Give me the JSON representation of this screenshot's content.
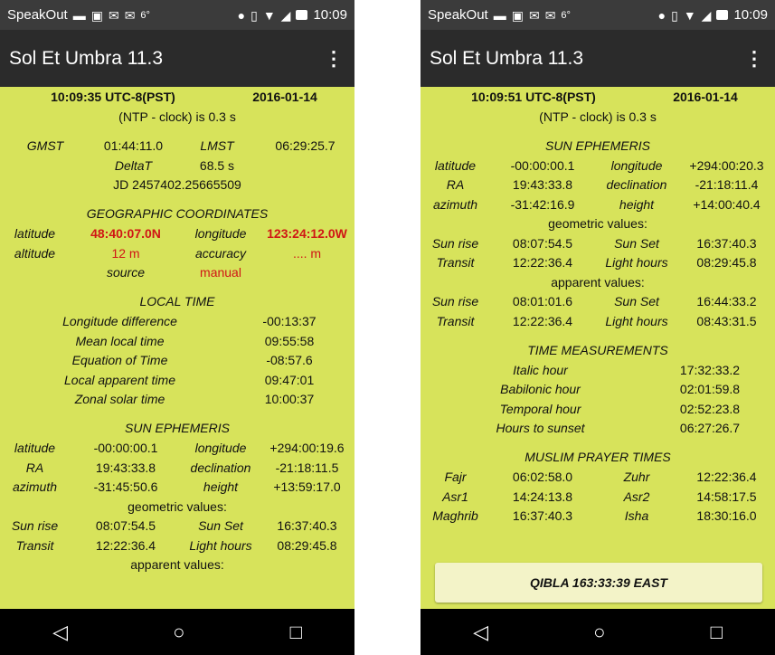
{
  "status_bar": {
    "app": "SpeakOut",
    "temp": "6°",
    "time": "10:09"
  },
  "left": {
    "app_title": "Sol Et Umbra 11.3",
    "time_line": {
      "time": "10:09:35 UTC-8(PST)",
      "date": "2016-01-14"
    },
    "ntp": "(NTP - clock) is 0.3 s",
    "sidereal": {
      "gmst_label": "GMST",
      "gmst": "01:44:11.0",
      "lmst_label": "LMST",
      "lmst": "06:29:25.7",
      "deltat_label": "DeltaT",
      "deltat": "68.5 s",
      "jd": "JD 2457402.25665509"
    },
    "geo": {
      "header": "GEOGRAPHIC COORDINATES",
      "lat_label": "latitude",
      "lat": "48:40:07.0N",
      "lon_label": "longitude",
      "lon": "123:24:12.0W",
      "alt_label": "altitude",
      "alt": "12 m",
      "acc_label": "accuracy",
      "acc": ".... m",
      "src_label": "source",
      "src": "manual"
    },
    "local_time": {
      "header": "LOCAL TIME",
      "rows": [
        {
          "label": "Longitude difference",
          "value": "-00:13:37"
        },
        {
          "label": "Mean local time",
          "value": "09:55:58"
        },
        {
          "label": "Equation of Time",
          "value": "-08:57.6"
        },
        {
          "label": "Local apparent time",
          "value": "09:47:01"
        },
        {
          "label": "Zonal solar time",
          "value": "10:00:37"
        }
      ]
    },
    "sun": {
      "header": "SUN EPHEMERIS",
      "rows": [
        {
          "a": "latitude",
          "b": "-00:00:00.1",
          "c": "longitude",
          "d": "+294:00:19.6"
        },
        {
          "a": "RA",
          "b": "19:43:33.8",
          "c": "declination",
          "d": "-21:18:11.5"
        },
        {
          "a": "azimuth",
          "b": "-31:45:50.6",
          "c": "height",
          "d": "+13:59:17.0"
        }
      ],
      "geometric": "geometric values:",
      "geo_rows": [
        {
          "a": "Sun rise",
          "b": "08:07:54.5",
          "c": "Sun Set",
          "d": "16:37:40.3"
        },
        {
          "a": "Transit",
          "b": "12:22:36.4",
          "c": "Light hours",
          "d": "08:29:45.8"
        }
      ],
      "apparent": "apparent values:"
    }
  },
  "right": {
    "app_title": "Sol Et Umbra 11.3",
    "time_line": {
      "time": "10:09:51 UTC-8(PST)",
      "date": "2016-01-14"
    },
    "ntp": "(NTP - clock) is 0.3 s",
    "sun": {
      "header": "SUN EPHEMERIS",
      "rows": [
        {
          "a": "latitude",
          "b": "-00:00:00.1",
          "c": "longitude",
          "d": "+294:00:20.3"
        },
        {
          "a": "RA",
          "b": "19:43:33.8",
          "c": "declination",
          "d": "-21:18:11.4"
        },
        {
          "a": "azimuth",
          "b": "-31:42:16.9",
          "c": "height",
          "d": "+14:00:40.4"
        }
      ],
      "geometric": "geometric values:",
      "geo_rows": [
        {
          "a": "Sun rise",
          "b": "08:07:54.5",
          "c": "Sun Set",
          "d": "16:37:40.3"
        },
        {
          "a": "Transit",
          "b": "12:22:36.4",
          "c": "Light hours",
          "d": "08:29:45.8"
        }
      ],
      "apparent": "apparent values:",
      "app_rows": [
        {
          "a": "Sun rise",
          "b": "08:01:01.6",
          "c": "Sun Set",
          "d": "16:44:33.2"
        },
        {
          "a": "Transit",
          "b": "12:22:36.4",
          "c": "Light hours",
          "d": "08:43:31.5"
        }
      ]
    },
    "time_measurements": {
      "header": "TIME MEASUREMENTS",
      "rows": [
        {
          "label": "Italic hour",
          "value": "17:32:33.2"
        },
        {
          "label": "Babilonic hour",
          "value": "02:01:59.8"
        },
        {
          "label": "Temporal hour",
          "value": "02:52:23.8"
        },
        {
          "label": "Hours to sunset",
          "value": "06:27:26.7"
        }
      ]
    },
    "muslim": {
      "header": "MUSLIM PRAYER TIMES",
      "rows": [
        {
          "a": "Fajr",
          "b": "06:02:58.0",
          "c": "Zuhr",
          "d": "12:22:36.4"
        },
        {
          "a": "Asr1",
          "b": "14:24:13.8",
          "c": "Asr2",
          "d": "14:58:17.5"
        },
        {
          "a": "Maghrib",
          "b": "16:37:40.3",
          "c": "Isha",
          "d": "18:30:16.0"
        }
      ]
    },
    "qibla": "QIBLA 163:33:39 EAST"
  },
  "icons": {
    "menu": "overflow-menu-icon",
    "back": "nav-back-icon",
    "home": "nav-home-icon",
    "recents": "nav-recents-icon"
  }
}
